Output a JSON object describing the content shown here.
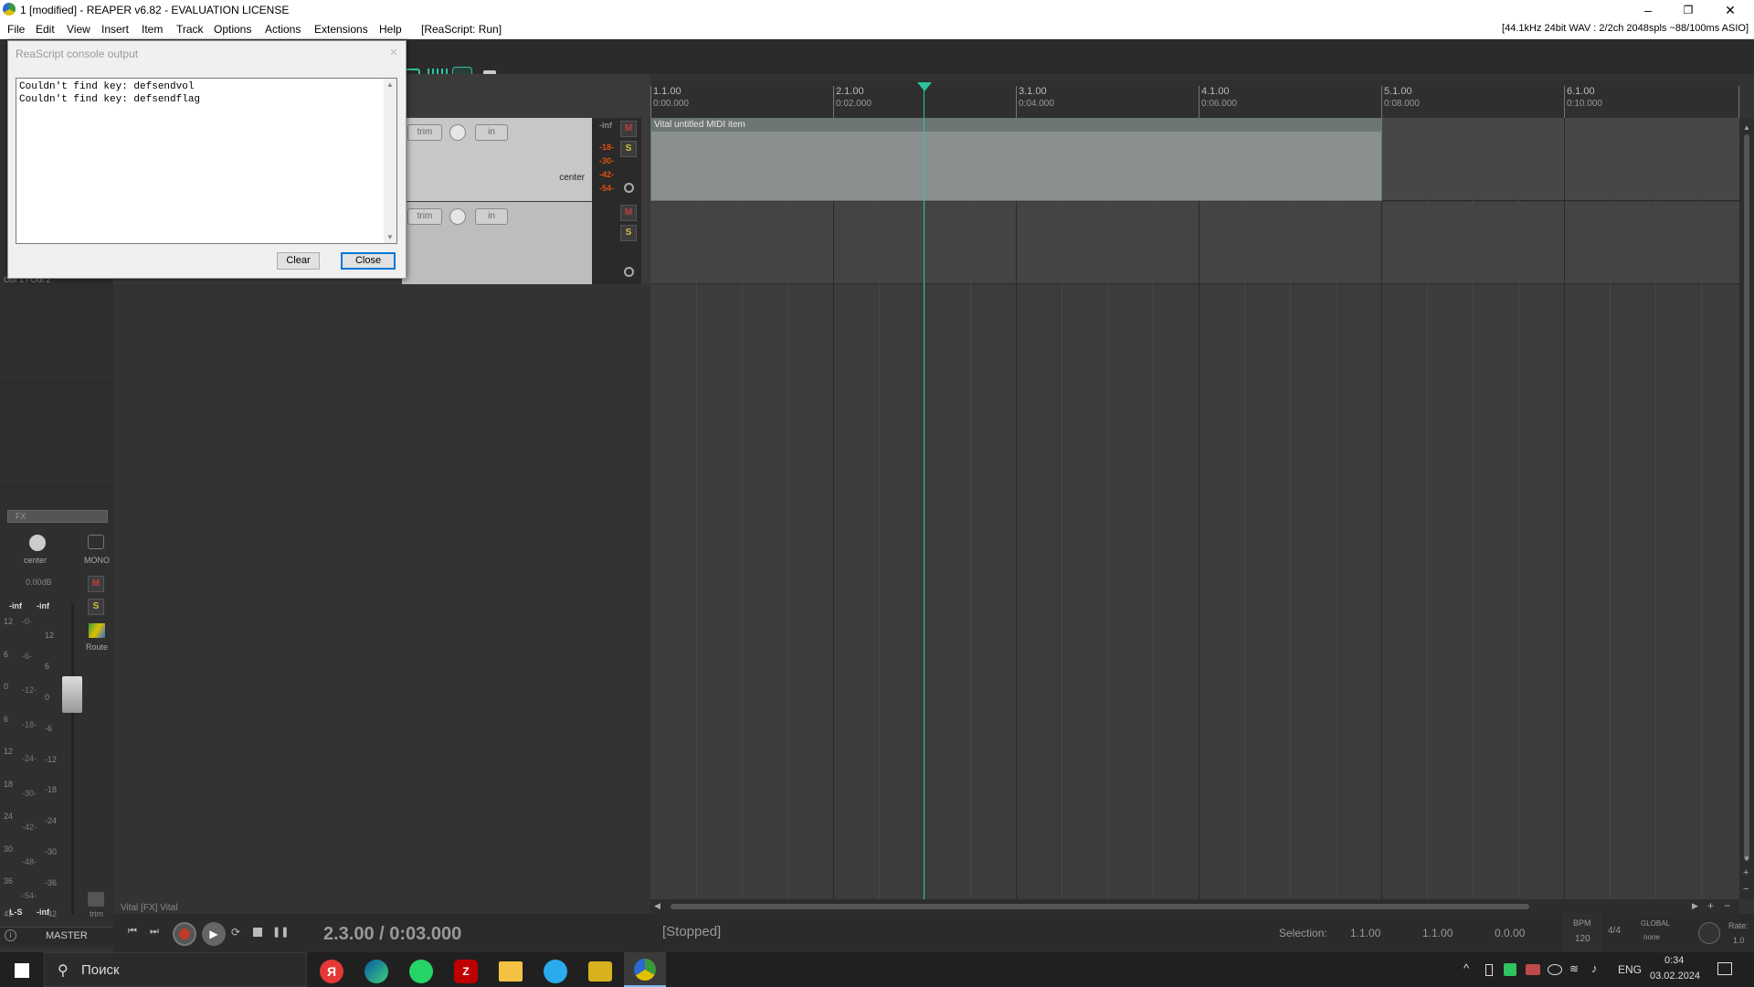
{
  "window": {
    "title": "1 [modified] - REAPER v6.82 - EVALUATION LICENSE",
    "controls": [
      "–",
      "❐",
      "✕"
    ]
  },
  "menu": {
    "items": [
      "File",
      "Edit",
      "View",
      "Insert",
      "Item",
      "Track",
      "Options",
      "Actions",
      "Extensions",
      "Help",
      "[ReaScript: Run]"
    ],
    "audio_status": "[44.1kHz 24bit WAV : 2/2ch 2048spls ~88/100ms ASIO]"
  },
  "dialog": {
    "title": "ReaScript console output",
    "lines": [
      "Couldn't find key: defsendvol",
      "Couldn't find key: defsendflag"
    ],
    "clear_label": "Clear",
    "close_label": "Close"
  },
  "tracks": [
    {
      "trim_label": "trim",
      "in_label": "in",
      "pan_label": "center",
      "mute": "M",
      "solo": "S"
    },
    {
      "trim_label": "trim",
      "in_label": "in",
      "mute": "M",
      "solo": "S"
    }
  ],
  "meter": {
    "labels": [
      "-inf",
      "-18-",
      "-30-",
      "-42-",
      "-54-"
    ]
  },
  "ruler": {
    "bars": [
      {
        "bar": "1.1.00",
        "time": "0:00.000"
      },
      {
        "bar": "2.1.00",
        "time": "0:02.000"
      },
      {
        "bar": "3.1.00",
        "time": "0:04.000"
      },
      {
        "bar": "4.1.00",
        "time": "0:06.000"
      },
      {
        "bar": "5.1.00",
        "time": "0:08.000"
      },
      {
        "bar": "6.1.00",
        "time": "0:10.000"
      }
    ]
  },
  "item": {
    "name": "Vital untitled MIDI item"
  },
  "master": {
    "out_label": "Out 1 / Out 2",
    "fx_label": "FX",
    "pan_label": "center",
    "mono_label": "MONO",
    "volume": "0.00dB",
    "peak_l": "-inf",
    "peak_r": "-inf",
    "mute": "M",
    "solo": "S",
    "route_label": "Route",
    "trim_label": "trim",
    "ls_label": "L-S",
    "ls_value": "-inf",
    "name": "MASTER",
    "scale_left": [
      "12",
      "6",
      "0",
      "6",
      "12",
      "18",
      "24",
      "30",
      "36",
      "42"
    ],
    "scale_mid": [
      "-0-",
      "-6-",
      "-12-",
      "-18-",
      "-24-",
      "-30-",
      "-42-",
      "-48-",
      "-54-"
    ],
    "scale_right": [
      "12",
      "6",
      "0",
      "-6",
      "-12",
      "-18",
      "-24",
      "-30",
      "-36",
      "-42"
    ]
  },
  "fx_status": "Vital [FX] Vital",
  "transport": {
    "position": "2.3.00 / 0:03.000",
    "state": "[Stopped]",
    "selection_label": "Selection:",
    "sel_start": "1.1.00",
    "sel_end": "1.1.00",
    "sel_len": "0.0.00",
    "bpm_label": "BPM",
    "bpm": "120",
    "time_sig": "4/4",
    "global_label": "GLOBAL",
    "global_value": "none",
    "rate_label": "Rate:",
    "rate": "1.0"
  },
  "taskbar": {
    "search_placeholder": "Поиск",
    "lang": "ENG",
    "time": "0:34",
    "date": "03.02.2024"
  },
  "colors": {
    "playhead": "#2ec2a0",
    "record": "#c0392b",
    "item": "#8a9090",
    "meter_label": "#e05010"
  }
}
